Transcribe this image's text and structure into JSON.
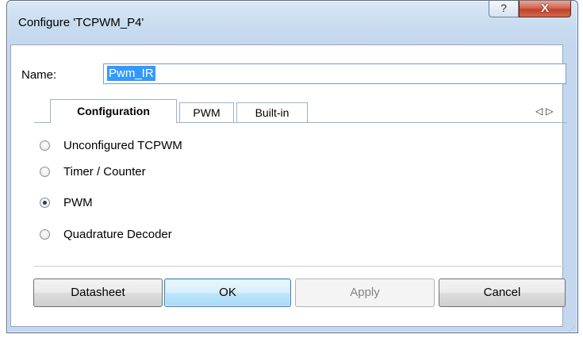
{
  "window": {
    "title": "Configure 'TCPWM_P4'",
    "help_glyph": "?",
    "close_glyph": "X"
  },
  "name_field": {
    "label": "Name:",
    "value": "Pwm_IR"
  },
  "tabs": [
    {
      "label": "Configuration",
      "active": true
    },
    {
      "label": "PWM",
      "active": false
    },
    {
      "label": "Built-in",
      "active": false
    }
  ],
  "tab_scroll": {
    "left": "◁",
    "right": "▷"
  },
  "options": [
    {
      "label": "Unconfigured TCPWM",
      "checked": false
    },
    {
      "label": "Timer / Counter",
      "checked": false
    },
    {
      "label": "PWM",
      "checked": true
    },
    {
      "label": "Quadrature Decoder",
      "checked": false
    }
  ],
  "buttons": {
    "datasheet": "Datasheet",
    "ok": "OK",
    "apply": "Apply",
    "cancel": "Cancel"
  }
}
